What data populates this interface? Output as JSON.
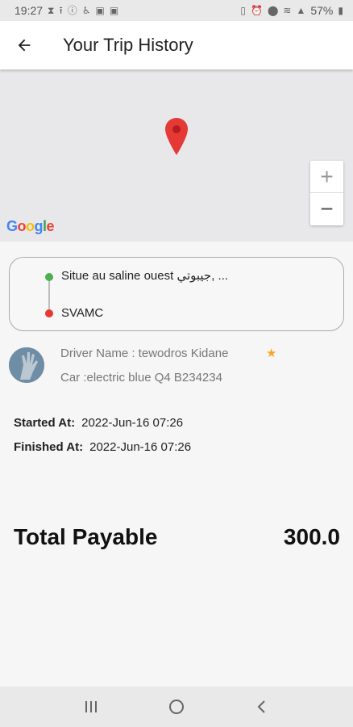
{
  "status_bar": {
    "time": "19:27",
    "battery": "57%",
    "left_icons": [
      "hourglass-icon",
      "upload-icon",
      "info-icon",
      "accessibility-icon",
      "image-icon",
      "image-icon"
    ],
    "right_icons": [
      "vibrate-icon",
      "alarm-icon",
      "location-icon",
      "wifi-icon",
      "signal-icon",
      "battery-icon"
    ]
  },
  "app_bar": {
    "title": "Your Trip History",
    "back_icon": "arrow-left-icon"
  },
  "map": {
    "google_logo": "Google",
    "zoom_in": "+",
    "zoom_out": "−",
    "pin_color": "#e53935"
  },
  "route": {
    "origin": "Situe au saline ouest جيبوتي, ...",
    "destination": "SVAMC",
    "origin_color": "#4caf50",
    "destination_color": "#e53935"
  },
  "driver": {
    "name_line": "Driver Name : tewodros Kidane",
    "car_line": "Car :electric blue Q4 B234234",
    "rating_icon": "star-icon",
    "star_color": "#f4a825"
  },
  "trip": {
    "started_label": "Started At:",
    "started_value": "2022-Jun-16 07:26",
    "finished_label": "Finished At:",
    "finished_value": "2022-Jun-16 07:26"
  },
  "payment": {
    "total_label": "Total Payable",
    "total_value": "300.0"
  },
  "nav_bar": {
    "buttons": [
      "recent-apps-icon",
      "home-icon",
      "back-icon"
    ]
  }
}
